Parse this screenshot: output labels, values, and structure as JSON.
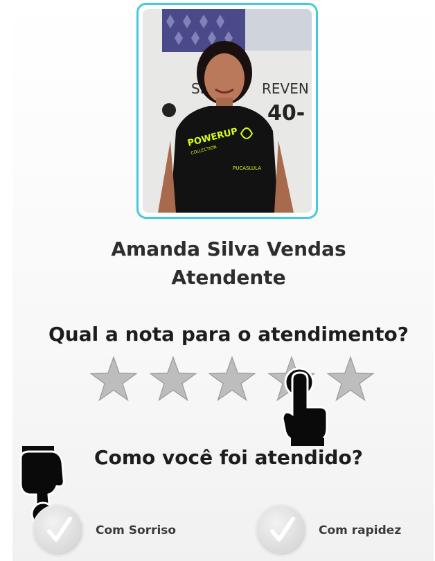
{
  "attendant": {
    "name": "Amanda Silva Vendas",
    "role": "Atendente",
    "photo_sign_text": "SE",
    "photo_sign_text2": "REVEN",
    "photo_phone_text": "40-",
    "shirt_text": "POWERUP",
    "shirt_sub": "COLLECTION",
    "shirt_brand": "PUCASLULA"
  },
  "rating": {
    "question": "Qual a nota para o atendimento?",
    "max_stars": 5,
    "selected": 0
  },
  "service": {
    "question": "Como você foi atendido?",
    "options": [
      {
        "label": "Com Sorriso",
        "checked": false
      },
      {
        "label": "Com rapidez",
        "checked": false
      }
    ]
  },
  "colors": {
    "frame_border": "#45c9dc",
    "star_fill": "#bdbdbd",
    "text": "#2d2d2d"
  },
  "icons": {
    "pointer_hand": "hand-pointer-icon",
    "star": "star-icon",
    "check": "check-icon"
  }
}
